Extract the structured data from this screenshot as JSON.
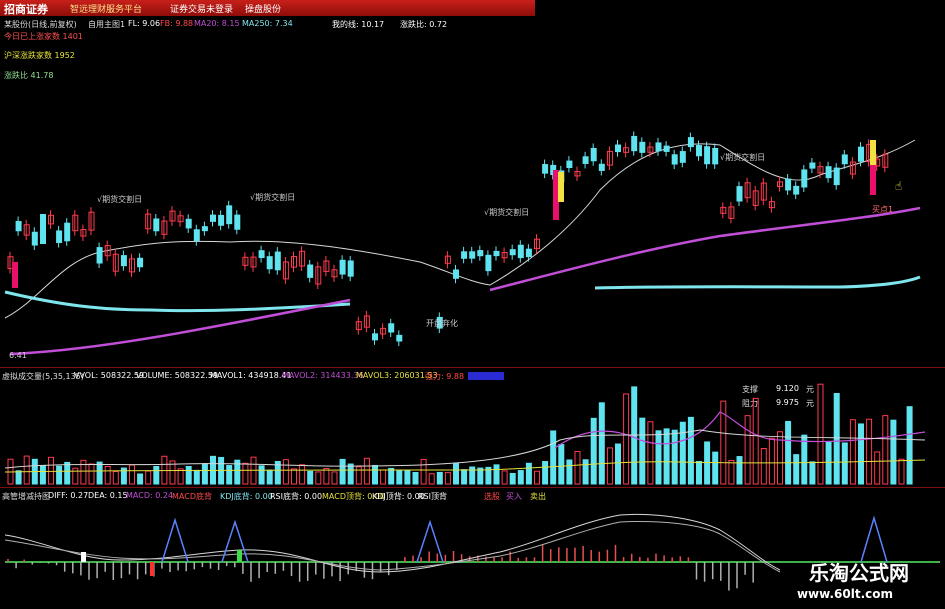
{
  "titlebar": {
    "brand": "招商证券",
    "slogan": "智远理财服务平台",
    "menu": [
      "证券交易未登录",
      "操盘股份"
    ]
  },
  "main_header": {
    "stock": "某股份(日线,前复权)",
    "ma_label": "自用主图1",
    "fl": "FL: 9.06",
    "fb": "FB: 9.88",
    "ma20": "MA20: 8.15",
    "ma250": "MA250: 7.34",
    "zhi": "我的线: 10.17",
    "ratio": "涨跌比: 0.72"
  },
  "side_info": {
    "l1": "今日已上涨家数 1401",
    "l2": "沪深涨跌家数 1952",
    "l3": "涨跌比 41.78"
  },
  "annotations": {
    "a1": "√期货交割日",
    "a2": "√期货交割日",
    "a3": "√期货交割日",
    "a4": "√期货交割日",
    "kaipan": "开盘弃化",
    "buy": "买点1",
    "low": "6.41"
  },
  "vol_header": {
    "title": "虚拟成交量(5,35,135)",
    "vvol": "VVOL: 508322.59",
    "volume": "VOLUME: 508322.59",
    "mavol1": "MAVOL1: 434918.41",
    "mavol2": "MAVOL2: 314433.36",
    "mavol3": "MAVOL3: 206031.53",
    "ratio": "强力: 9.88"
  },
  "vol_side": {
    "support_label": "支撑",
    "support_val": "9.120",
    "support_unit": "元",
    "pressure_label": "阻力",
    "pressure_val": "9.975",
    "pressure_unit": "元"
  },
  "macd_header": {
    "title": "高管增减持图",
    "diff": "DIFF: 0.27",
    "dea": "DEA: 0.15",
    "macd": "MACD: 0.24",
    "f1": "MACD底背",
    "f2": "KDJ底背: 0.00",
    "f3": "RSI底背: 0.00",
    "f4": "MACD顶背: 0.00",
    "f5": "KDJ顶背: 0.00",
    "f6": "RSI顶背",
    "f7": "选股",
    "f8": "买入",
    "f9": "卖出"
  },
  "watermark": {
    "name": "乐淘公式网",
    "url": "www.60lt.com"
  },
  "colors": {
    "up": "#ff3b4f",
    "down": "#5fe3ef",
    "magenta": "#c04ed6",
    "cyan": "#7fe6ee",
    "yellow": "#f2e140",
    "white": "#d8d8d8"
  }
}
